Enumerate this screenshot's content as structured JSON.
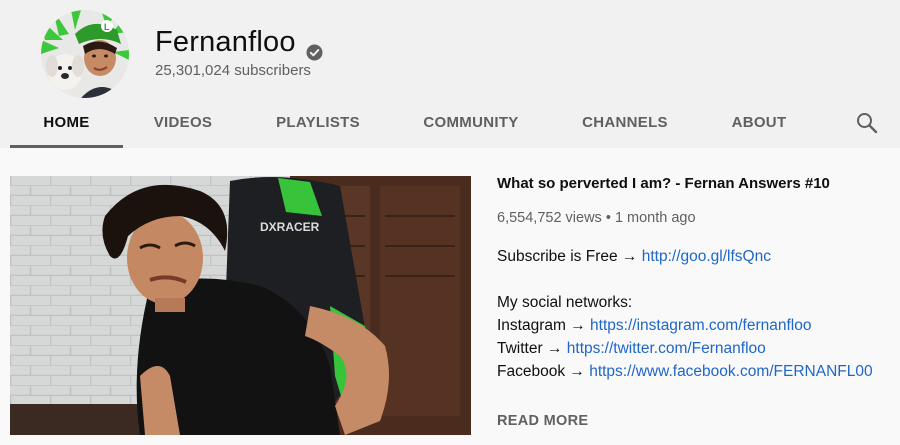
{
  "channel": {
    "name": "Fernanfloo",
    "subscribers": "25,301,024 subscribers",
    "verified_icon": "verified-check-icon"
  },
  "tabs": [
    {
      "label": "HOME",
      "active": true
    },
    {
      "label": "VIDEOS",
      "active": false
    },
    {
      "label": "PLAYLISTS",
      "active": false
    },
    {
      "label": "COMMUNITY",
      "active": false
    },
    {
      "label": "CHANNELS",
      "active": false
    },
    {
      "label": "ABOUT",
      "active": false
    }
  ],
  "search_icon": "search-icon",
  "featured": {
    "thumbnail_brand": "DXRACER",
    "title": "What so perverted I am? - Fernan Answers #10",
    "views": "6,554,752 views",
    "separator": "•",
    "age": "1 month ago",
    "subscribe_text": "Subscribe is Free →",
    "subscribe_link": "http://goo.gl/lfsQnc",
    "social_heading": "My social networks:",
    "social": [
      {
        "label": "Instagram →",
        "url": "https://instagram.com/fernanfloo"
      },
      {
        "label": "Twitter →",
        "url": "https://twitter.com/Fernanfloo"
      },
      {
        "label": "Facebook →",
        "url": "https://www.facebook.com/FERNANFL00"
      }
    ],
    "read_more": "READ MORE"
  },
  "colors": {
    "link": "#1f66c7",
    "accent_green": "#35c43a",
    "header_bg": "#f1f1f1",
    "tab_text": "#606060"
  }
}
